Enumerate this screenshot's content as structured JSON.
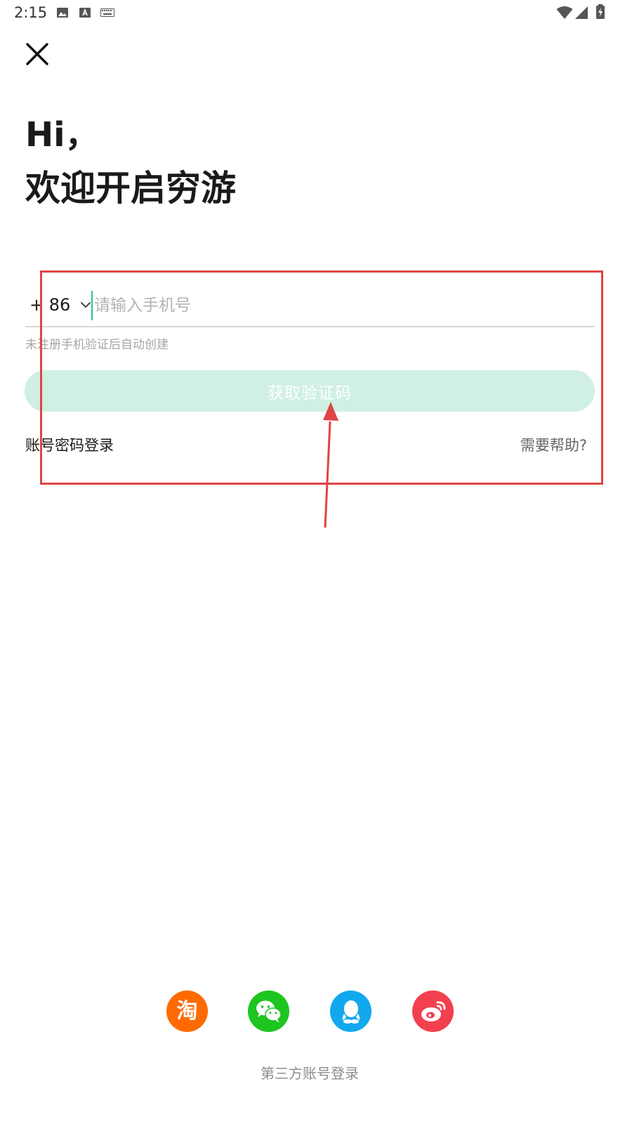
{
  "status_bar": {
    "time": "2:15"
  },
  "greeting": {
    "line1": "Hi，",
    "line2": "欢迎开启穷游"
  },
  "login_form": {
    "country_code": "+ 86",
    "phone_placeholder": "请输入手机号",
    "phone_value": "",
    "register_hint": "未注册手机验证后自动创建",
    "get_code_label": "获取验证码",
    "password_login_label": "账号密码登录",
    "help_label": "需要帮助?"
  },
  "third_party": {
    "label": "第三方账号登录",
    "providers": [
      {
        "icon": "taobao-icon",
        "glyph": "淘",
        "color": "#ff6a00"
      },
      {
        "icon": "wechat-icon",
        "color": "#1ec51e"
      },
      {
        "icon": "qq-icon",
        "color": "#12a8ee"
      },
      {
        "icon": "weibo-icon",
        "color": "#f2404f"
      }
    ]
  },
  "colors": {
    "accent": "#2fc38a",
    "button_disabled_bg": "#cff0e2",
    "annotation": "#e04444"
  }
}
